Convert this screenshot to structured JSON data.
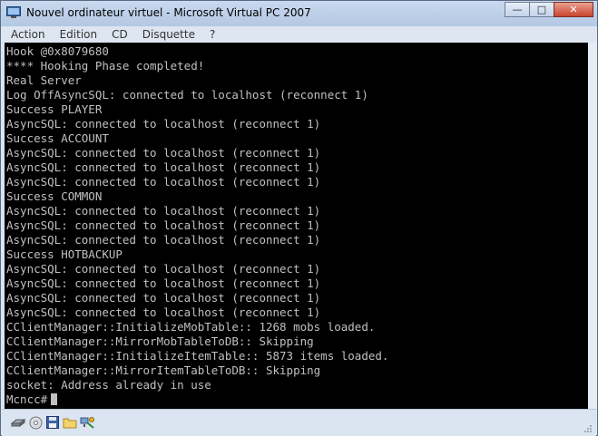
{
  "window": {
    "title": "Nouvel ordinateur virtuel - Microsoft Virtual PC 2007"
  },
  "menu": [
    {
      "label": "Action"
    },
    {
      "label": "Edition"
    },
    {
      "label": "CD"
    },
    {
      "label": "Disquette"
    },
    {
      "label": "?"
    }
  ],
  "console": {
    "lines": [
      "Hook @0x8079680",
      "**** Hooking Phase completed!",
      "Real Server",
      "Log OffAsyncSQL: connected to localhost (reconnect 1)",
      "Success PLAYER",
      "AsyncSQL: connected to localhost (reconnect 1)",
      "Success ACCOUNT",
      "AsyncSQL: connected to localhost (reconnect 1)",
      "AsyncSQL: connected to localhost (reconnect 1)",
      "AsyncSQL: connected to localhost (reconnect 1)",
      "Success COMMON",
      "AsyncSQL: connected to localhost (reconnect 1)",
      "AsyncSQL: connected to localhost (reconnect 1)",
      "AsyncSQL: connected to localhost (reconnect 1)",
      "Success HOTBACKUP",
      "AsyncSQL: connected to localhost (reconnect 1)",
      "AsyncSQL: connected to localhost (reconnect 1)",
      "AsyncSQL: connected to localhost (reconnect 1)",
      "AsyncSQL: connected to localhost (reconnect 1)",
      "CClientManager::InitializeMobTable:: 1268 mobs loaded.",
      "CClientManager::MirrorMobTableToDB:: Skipping",
      "CClientManager::InitializeItemTable:: 5873 items loaded.",
      "CClientManager::MirrorItemTableToDB:: Skipping",
      "socket: Address already in use"
    ],
    "prompt": "Mcncc#"
  },
  "status_icons": [
    "hard-disk-icon",
    "cd-icon",
    "floppy-icon",
    "shared-folder-icon",
    "network-icon"
  ],
  "colors": {
    "console_bg": "#000000",
    "console_fg": "#c0c0c0"
  }
}
